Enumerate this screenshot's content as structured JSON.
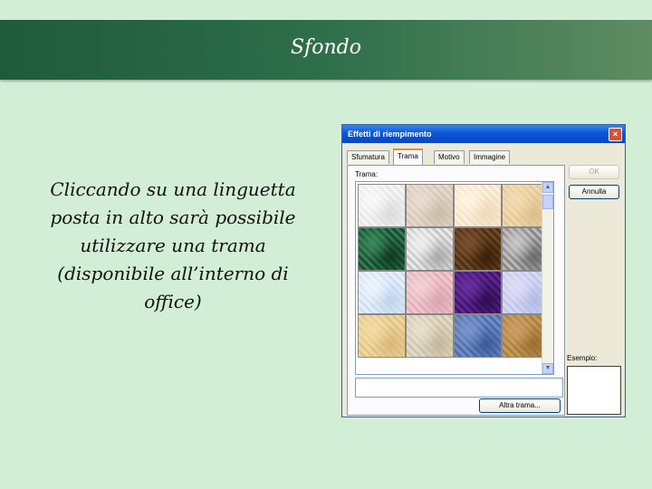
{
  "slide": {
    "title": "Sfondo",
    "caption": "Cliccando su una linguetta posta in alto sarà possibile utilizzare una trama (disponibile all’interno di office)"
  },
  "dialog": {
    "title": "Effetti di riempimento",
    "close_symbol": "×",
    "tabs": [
      {
        "label": "Sfumatura",
        "active": false
      },
      {
        "label": "Trama",
        "active": true
      },
      {
        "label": "Motivo",
        "active": false
      },
      {
        "label": "Immagine",
        "active": false
      }
    ],
    "texture_label": "Trama:",
    "ok_label": "OK",
    "cancel_label": "Annulla",
    "other_texture_label": "Altra trama...",
    "example_label": "Esempio:",
    "scroll_up_symbol": "▲",
    "scroll_down_symbol": "▼",
    "textures": [
      {
        "name": "giornale",
        "colors": [
          "#eeeeee",
          "#f9f9f9",
          "#dcdcdc"
        ]
      },
      {
        "name": "tela",
        "colors": [
          "#ddd0c2",
          "#e8ddd0",
          "#cbbcab"
        ]
      },
      {
        "name": "pergamena",
        "colors": [
          "#f8e8d0",
          "#fff4e2",
          "#efd9b8"
        ]
      },
      {
        "name": "carta",
        "colors": [
          "#ead0a0",
          "#f2dcb2",
          "#ddbf8a"
        ]
      },
      {
        "name": "marmo verde",
        "colors": [
          "#1e5a38",
          "#3a8a5c",
          "#0f3a22"
        ]
      },
      {
        "name": "marmo bianco",
        "colors": [
          "#d8d8d8",
          "#f0f0f0",
          "#a8a8a8"
        ]
      },
      {
        "name": "marmo marrone",
        "colors": [
          "#5a3818",
          "#7a5030",
          "#3a2008"
        ]
      },
      {
        "name": "granito",
        "colors": [
          "#9a9a9a",
          "#c8c8c8",
          "#6a6a6a"
        ]
      },
      {
        "name": "gocce",
        "colors": [
          "#d8e6f6",
          "#eef4fc",
          "#c0d4ee"
        ]
      },
      {
        "name": "carta rosa",
        "colors": [
          "#e8b8c0",
          "#f4d0d4",
          "#dca4ae"
        ]
      },
      {
        "name": "viola",
        "colors": [
          "#4a1a7a",
          "#6a2ea0",
          "#2e0e52"
        ]
      },
      {
        "name": "bolle",
        "colors": [
          "#c8d0ee",
          "#e2dcf6",
          "#b0bce6"
        ]
      },
      {
        "name": "carta da pacchi",
        "colors": [
          "#e8cc8e",
          "#f4dca8",
          "#d8b878"
        ]
      },
      {
        "name": "tela di sacco",
        "colors": [
          "#d8ceb8",
          "#e8e0cc",
          "#c4b89c"
        ]
      },
      {
        "name": "denim",
        "colors": [
          "#5a7ab8",
          "#7a96cc",
          "#3c5a98"
        ]
      },
      {
        "name": "iuta",
        "colors": [
          "#b88a4a",
          "#cca064",
          "#9a6e32"
        ]
      }
    ]
  }
}
